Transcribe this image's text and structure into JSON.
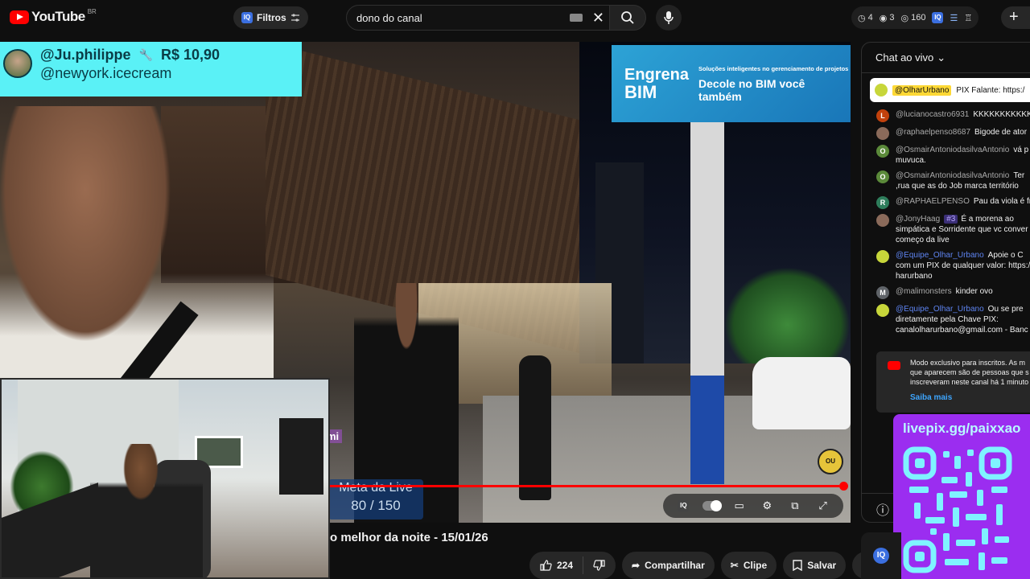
{
  "topbar": {
    "logo_text": "YouTube",
    "logo_country": "BR",
    "filtros_label": "Filtros",
    "iq_label": "IQ",
    "search_value": "dono do canal",
    "stats": {
      "clock": "4",
      "views": "3",
      "watchers": "160"
    }
  },
  "video": {
    "ad": {
      "brand_line1": "Engrena",
      "brand_line2": "BIM",
      "tagline": "Soluções inteligentes no gerenciamento de projetos",
      "cta": "Decole no BIM você também"
    },
    "donation": {
      "user": "@Ju.philippe",
      "amount": "R$ 10,90",
      "message": "@newyork.icecream"
    },
    "mi_tag": "mi",
    "meta": {
      "title": "Meta da Live",
      "value": "80 / 150"
    },
    "progress_fraction": 0.993,
    "title": "o melhor da noite - 15/01/26"
  },
  "actions": {
    "likes": "224",
    "share": "Compartilhar",
    "clip": "Clipe",
    "save": "Salvar"
  },
  "chat": {
    "header": "Chat ao vivo",
    "pinned": {
      "author": "@OlharUrbano",
      "text": "PIX Falante: https:/"
    },
    "messages": [
      {
        "initial": "L",
        "color": "#c2410c",
        "author": "@lucianocastro6931",
        "text": "KKKKKKKKKKK",
        "mod": false
      },
      {
        "initial": "",
        "color": "#8a6a5a",
        "author": "@raphaelpenso8687",
        "text": "Bigode de ator",
        "mod": false
      },
      {
        "initial": "O",
        "color": "#5b8a3a",
        "author": "@OsmairAntoniodasilvaAntonio",
        "text": "vá p muvuca.",
        "mod": false
      },
      {
        "initial": "O",
        "color": "#5b8a3a",
        "author": "@OsmairAntoniodasilvaAntonio",
        "text": "Ter ,rua que as do Job marca território",
        "mod": false
      },
      {
        "initial": "R",
        "color": "#2e7d5b",
        "author": "@RAPHAELPENSO",
        "text": "Pau da viola é fr",
        "mod": false
      },
      {
        "initial": "",
        "color": "#8a6a5a",
        "author": "@JonyHaag",
        "badge": "#3",
        "text": "É a morena ao simpática e Sorridente que vc conver começo da live",
        "mod": false
      },
      {
        "initial": "",
        "color": "#c7d63a",
        "author": "@Equipe_Olhar_Urbano",
        "text": "Apoie o C com um PIX de qualquer valor: https:/ harurbano",
        "mod": true
      },
      {
        "initial": "M",
        "color": "#5f6368",
        "author": "@malimonsters",
        "text": "kinder ovo",
        "mod": false
      },
      {
        "initial": "",
        "color": "#c7d63a",
        "author": "@Equipe_Olhar_Urbano",
        "text": "Ou se pre diretamente pela Chave PIX: canalolharurbano@gmail.com - Banc",
        "mod": true
      }
    ],
    "members_notice": "Modo exclusivo para inscritos. As m que aparecem são de pessoas que s inscreveram neste canal há 1 minuto",
    "saiba_mais": "Saiba mais",
    "qr_title": "livepix.gg/paixxao"
  },
  "colors": {
    "accent": "#ff0000",
    "donation_bg": "#5af1f6",
    "qr_bg": "#9b2df0"
  }
}
